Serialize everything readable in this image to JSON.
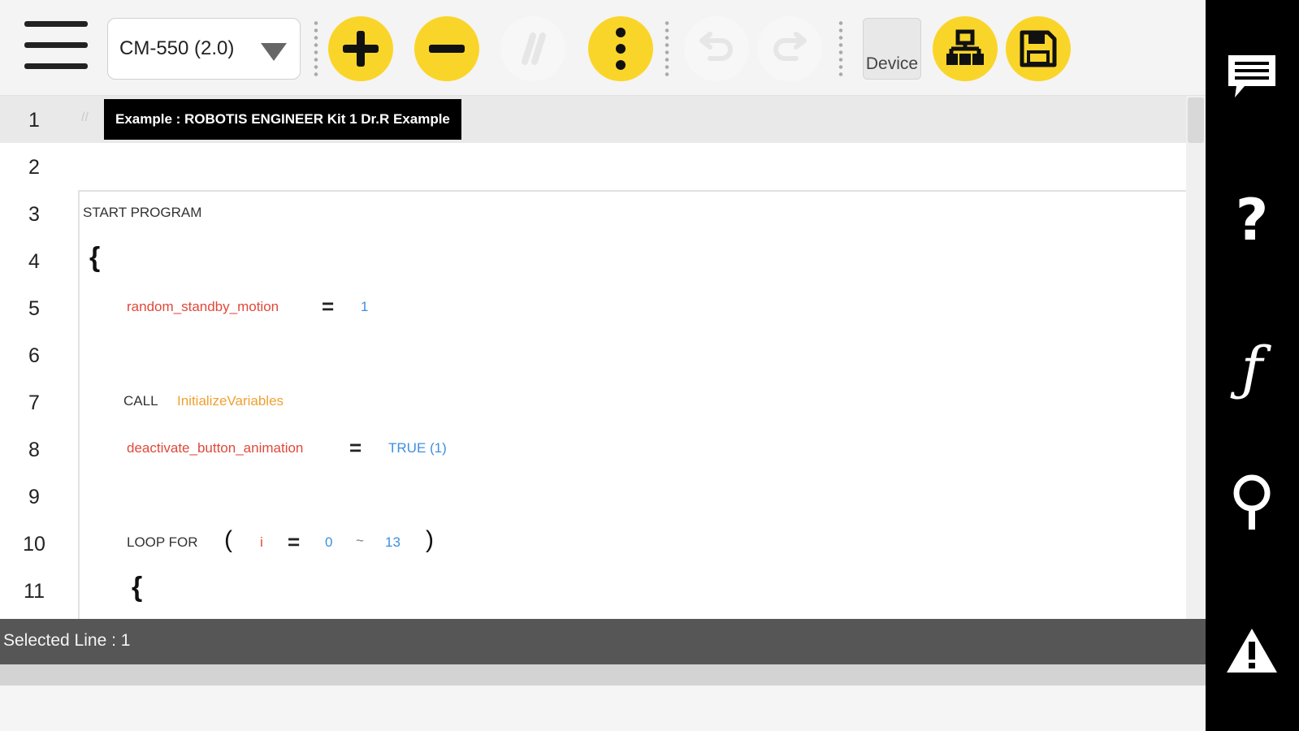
{
  "toolbar": {
    "device_select": {
      "value": "CM-550 (2.0)"
    },
    "device_tab_label": "Device"
  },
  "editor": {
    "title_chip": "Example : ROBOTIS ENGINEER Kit 1 Dr.R Example",
    "line_numbers": [
      "1",
      "2",
      "3",
      "4",
      "5",
      "6",
      "7",
      "8",
      "9",
      "10",
      "11"
    ],
    "selected_line": 1,
    "code": {
      "start_program": "START PROGRAM",
      "open_brace": "{",
      "assign1": {
        "variable": "random_standby_motion",
        "operator": "=",
        "value": "1"
      },
      "call": {
        "keyword": "CALL",
        "function": "InitializeVariables"
      },
      "assign2": {
        "variable": "deactivate_button_animation",
        "operator": "=",
        "value": "TRUE (1)"
      },
      "loop": {
        "keyword": "LOOP FOR",
        "open_paren": "(",
        "variable": "i",
        "operator": "=",
        "start": "0",
        "range_sep": "~",
        "end": "13",
        "close_paren": ")"
      },
      "loop_brace": "{"
    }
  },
  "status": {
    "text": "Selected Line : 1"
  },
  "colors": {
    "accent_yellow": "#fad529",
    "variable_red": "#e0483a",
    "number_blue": "#3d8fe0",
    "function_orange": "#f0a030",
    "sidebar_black": "#000000",
    "status_gray": "#565656"
  },
  "icons": {
    "menu": "hamburger-icon",
    "dropdown": "chevron-down-icon",
    "add": "plus-icon",
    "remove": "minus-icon",
    "comment": "comment-slash-icon",
    "more": "vertical-dots-icon",
    "undo": "undo-icon",
    "redo": "redo-icon",
    "hierarchy": "hierarchy-icon",
    "save": "save-icon",
    "chat": "chat-icon",
    "help": "question-icon",
    "function": "function-icon",
    "search": "magnifier-icon",
    "warning": "warning-icon"
  }
}
